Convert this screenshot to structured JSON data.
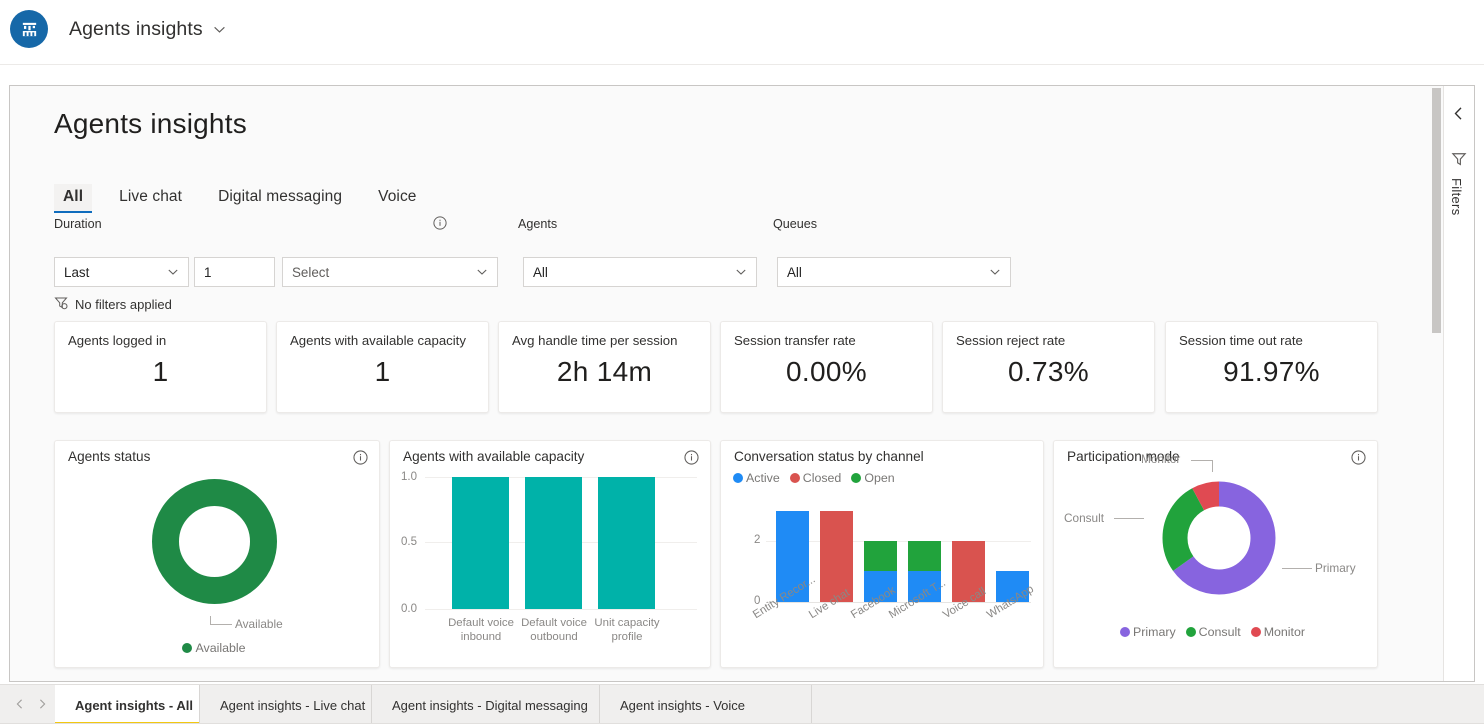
{
  "appbar": {
    "logo_icon": "dashboard-chart-icon",
    "title": "Agents insights",
    "chevron_icon": "chevron-down-icon"
  },
  "page": {
    "title": "Agents insights"
  },
  "tabs": [
    {
      "label": "All",
      "active": true
    },
    {
      "label": "Live chat",
      "active": false
    },
    {
      "label": "Digital messaging",
      "active": false
    },
    {
      "label": "Voice",
      "active": false
    }
  ],
  "filters": {
    "duration": {
      "label": "Duration",
      "info_icon": "info-icon",
      "operator_value": "Last",
      "number_value": "1",
      "unit_value": "Select",
      "unit_placeholder": "Select"
    },
    "agents": {
      "label": "Agents",
      "value": "All"
    },
    "queues": {
      "label": "Queues",
      "value": "All"
    },
    "status_icon": "filter-off-icon",
    "status_text": "No filters applied"
  },
  "kpis": [
    {
      "title": "Agents logged in",
      "value": "1"
    },
    {
      "title": "Agents with available capacity",
      "value": "1"
    },
    {
      "title": "Avg handle time per session",
      "value": "2h 14m"
    },
    {
      "title": "Session transfer rate",
      "value": "0.00%"
    },
    {
      "title": "Session reject rate",
      "value": "0.73%"
    },
    {
      "title": "Session time out rate",
      "value": "91.97%"
    }
  ],
  "cards": {
    "agents_status": {
      "title": "Agents status",
      "info_icon": "info-icon",
      "callout": "Available",
      "legend": "Available"
    },
    "available_capacity": {
      "title": "Agents with available capacity",
      "info_icon": "info-icon"
    },
    "conversation_status": {
      "title": "Conversation status by channel"
    },
    "participation_mode": {
      "title": "Participation mode",
      "info_icon": "info-icon"
    }
  },
  "chart_data": [
    {
      "type": "pie",
      "title": "Agents status",
      "labels": [
        "Available"
      ],
      "values": [
        1
      ],
      "colors": [
        "#1f8a46"
      ],
      "legend": [
        "Available"
      ],
      "legend_position": "bottom",
      "annotations": [
        "Available"
      ]
    },
    {
      "type": "bar",
      "title": "Agents with available capacity",
      "categories": [
        "Default voice inbound",
        "Default voice outbound",
        "Unit capacity profile"
      ],
      "values": [
        1.0,
        1.0,
        1.0
      ],
      "ytick_labels": [
        "0.0",
        "0.5",
        "1.0"
      ],
      "ylim": [
        0,
        1
      ],
      "color": "#00b2a9",
      "xlabel": "",
      "ylabel": "",
      "grid": true,
      "legend_position": "none"
    },
    {
      "type": "bar",
      "title": "Conversation status by channel",
      "stacked": true,
      "categories": [
        "Entity Recor...",
        "Live chat",
        "Facebook",
        "Microsoft T...",
        "Voice call",
        "WhatsApp"
      ],
      "series": [
        {
          "name": "Active",
          "color": "#1f8bf5",
          "values": [
            3,
            0,
            1,
            1,
            0,
            1
          ]
        },
        {
          "name": "Closed",
          "color": "#d9534f",
          "values": [
            0,
            3,
            0,
            0,
            2,
            0
          ]
        },
        {
          "name": "Open",
          "color": "#21a33c",
          "values": [
            0,
            0,
            1,
            1,
            0,
            0
          ]
        }
      ],
      "ytick_labels": [
        "0",
        "2"
      ],
      "ylim": [
        0,
        3
      ],
      "legend": [
        "Active",
        "Closed",
        "Open"
      ],
      "legend_position": "top",
      "grid": true
    },
    {
      "type": "pie",
      "title": "Participation mode",
      "labels": [
        "Primary",
        "Consult",
        "Monitor"
      ],
      "values": [
        65,
        27,
        8
      ],
      "colors": [
        "#8764df",
        "#21a33c",
        "#e04a52"
      ],
      "legend": [
        "Primary",
        "Consult",
        "Monitor"
      ],
      "legend_position": "bottom",
      "annotations": [
        "Monitor",
        "Consult",
        "Primary"
      ]
    }
  ],
  "right_rail": {
    "collapse_icon": "chevron-left-icon",
    "filter_icon": "funnel-icon",
    "filters_label": "Filters"
  },
  "bottom_tabs": {
    "prev_icon": "chevron-left-icon",
    "next_icon": "chevron-right-icon",
    "items": [
      {
        "label": "Agent insights - All",
        "active": true
      },
      {
        "label": "Agent insights - Live chat",
        "active": false
      },
      {
        "label": "Agent insights - Digital messaging",
        "active": false
      },
      {
        "label": "Agent insights - Voice",
        "active": false
      }
    ]
  },
  "colors": {
    "accent": "#0f6cbd",
    "logo_bg": "#1668a8",
    "teal": "#00b2a9",
    "green": "#1f8a46",
    "blue": "#1f8bf5",
    "red": "#d9534f",
    "purple": "#8764df",
    "active_tab_underline": "#f2c811"
  }
}
